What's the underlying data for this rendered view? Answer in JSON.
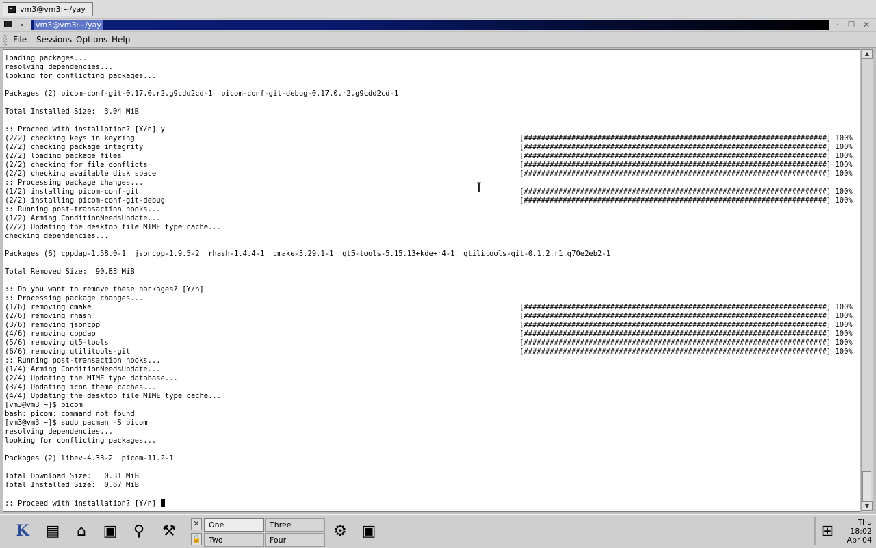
{
  "tab": {
    "title": "vm3@vm3:~/yay"
  },
  "window": {
    "title": "vm3@vm3:~/yay"
  },
  "menu": {
    "file": "File",
    "sessions": "Sessions",
    "options": "Options",
    "help": "Help"
  },
  "terminal": {
    "lines": [
      "loading packages...",
      "resolving dependencies...",
      "looking for conflicting packages...",
      "",
      "Packages (2) picom-conf-git-0.17.0.r2.g9cdd2cd-1  picom-conf-git-debug-0.17.0.r2.g9cdd2cd-1",
      "",
      "Total Installed Size:  3.04 MiB",
      "",
      ":: Proceed with installation? [Y/n] y",
      "(2/2) checking keys in keyring",
      "(2/2) checking package integrity",
      "(2/2) loading package files",
      "(2/2) checking for file conflicts",
      "(2/2) checking available disk space",
      ":: Processing package changes...",
      "(1/2) installing picom-conf-git",
      "(2/2) installing picom-conf-git-debug",
      ":: Running post-transaction hooks...",
      "(1/2) Arming ConditionNeedsUpdate...",
      "(2/2) Updating the desktop file MIME type cache...",
      "checking dependencies...",
      "",
      "Packages (6) cppdap-1.58.0-1  jsoncpp-1.9.5-2  rhash-1.4.4-1  cmake-3.29.1-1  qt5-tools-5.15.13+kde+r4-1  qtilitools-git-0.1.2.r1.g70e2eb2-1",
      "",
      "Total Removed Size:  90.83 MiB",
      "",
      ":: Do you want to remove these packages? [Y/n]",
      ":: Processing package changes...",
      "(1/6) removing cmake",
      "(2/6) removing rhash",
      "(3/6) removing jsoncpp",
      "(4/6) removing cppdap",
      "(5/6) removing qt5-tools",
      "(6/6) removing qtilitools-git",
      ":: Running post-transaction hooks...",
      "(1/4) Arming ConditionNeedsUpdate...",
      "(2/4) Updating the MIME type database...",
      "(3/4) Updating icon theme caches...",
      "(4/4) Updating the desktop file MIME type cache...",
      "[vm3@vm3 ~]$ picom",
      "bash: picom: command not found",
      "[vm3@vm3 ~]$ sudo pacman -S picom",
      "resolving dependencies...",
      "looking for conflicting packages...",
      "",
      "Packages (2) libev-4.33-2  picom-11.2-1",
      "",
      "Total Download Size:   0.31 MiB",
      "Total Installed Size:  0.67 MiB",
      "",
      ":: Proceed with installation? [Y/n] "
    ],
    "progress_bar": "[######################################################################] 100%",
    "progress_rows": [
      9,
      10,
      11,
      12,
      13,
      15,
      16,
      28,
      29,
      30,
      31,
      32,
      33
    ]
  },
  "taskbar": {
    "launchers": [
      "kde-menu-icon",
      "window-list-icon",
      "home-folder-icon",
      "terminal-icon",
      "search-icon",
      "package-tools-icon"
    ],
    "desktops": [
      "One",
      "Two",
      "Three",
      "Four"
    ],
    "active_desktop": "One",
    "clock": {
      "day": "Thu",
      "time": "18:02",
      "date": "Apr 04"
    }
  }
}
